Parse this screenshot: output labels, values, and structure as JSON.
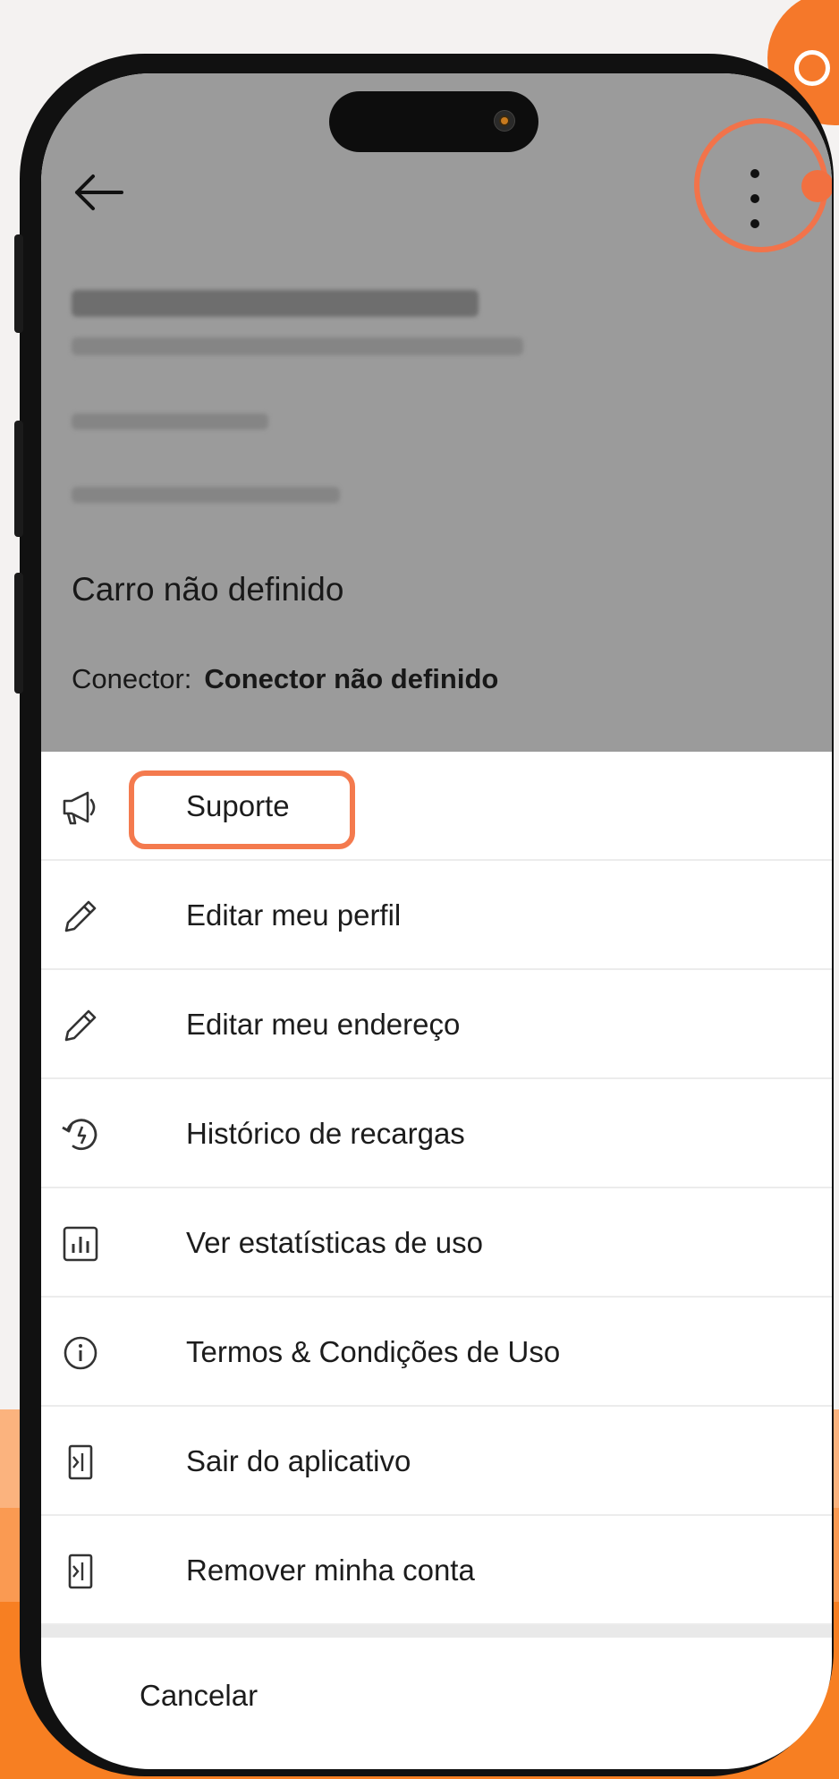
{
  "header": {
    "back_icon": "arrow-left-icon",
    "more_icon": "more-vertical-icon"
  },
  "profile": {
    "car_text": "Carro não definido",
    "connector_label": "Conector:",
    "connector_value": "Conector não definido"
  },
  "menu": {
    "items": [
      {
        "label": "Suporte",
        "icon": "megaphone-icon"
      },
      {
        "label": "Editar meu perfil",
        "icon": "pencil-icon"
      },
      {
        "label": "Editar meu endereço",
        "icon": "pencil-icon"
      },
      {
        "label": "Histórico de recargas",
        "icon": "history-icon"
      },
      {
        "label": "Ver estatísticas de uso",
        "icon": "bar-chart-icon"
      },
      {
        "label": "Termos & Condições de Uso",
        "icon": "info-icon"
      },
      {
        "label": "Sair do aplicativo",
        "icon": "exit-icon"
      },
      {
        "label": "Remover minha conta",
        "icon": "exit-icon"
      }
    ],
    "cancel_label": "Cancelar"
  },
  "colors": {
    "accent": "#f47a4e",
    "overlay": "#9b9b9b",
    "brand_orange": "#f77f22"
  }
}
